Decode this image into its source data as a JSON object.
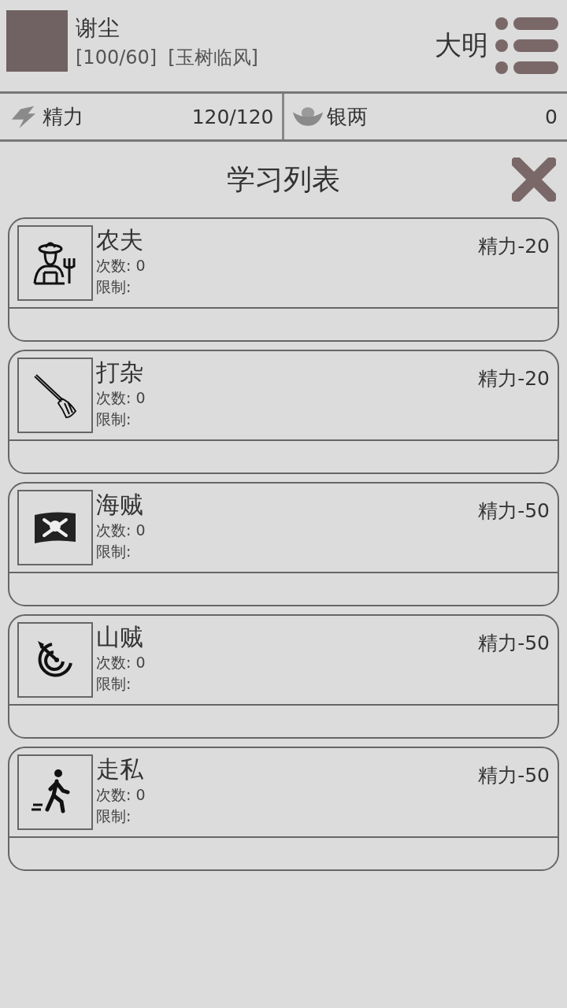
{
  "player": {
    "name": "谢尘",
    "stats": "[100/60]",
    "title": "[玉树临风]",
    "dynasty": "大明"
  },
  "resources": [
    {
      "kind": "energy",
      "label": "精力",
      "value": "120/120"
    },
    {
      "kind": "silver",
      "label": "银两",
      "value": "0"
    }
  ],
  "panel": {
    "title": "学习列表"
  },
  "jobs": [
    {
      "kind": "farmer",
      "name": "农夫",
      "cost": "精力-20",
      "count": "次数: 0",
      "limit": "限制:"
    },
    {
      "kind": "broom",
      "name": "打杂",
      "cost": "精力-20",
      "count": "次数: 0",
      "limit": "限制:"
    },
    {
      "kind": "pirate",
      "name": "海贼",
      "cost": "精力-50",
      "count": "次数: 0",
      "limit": "限制:"
    },
    {
      "kind": "target",
      "name": "山贼",
      "cost": "精力-50",
      "count": "次数: 0",
      "limit": "限制:"
    },
    {
      "kind": "walker",
      "name": "走私",
      "cost": "精力-50",
      "count": "次数: 0",
      "limit": "限制:"
    }
  ]
}
